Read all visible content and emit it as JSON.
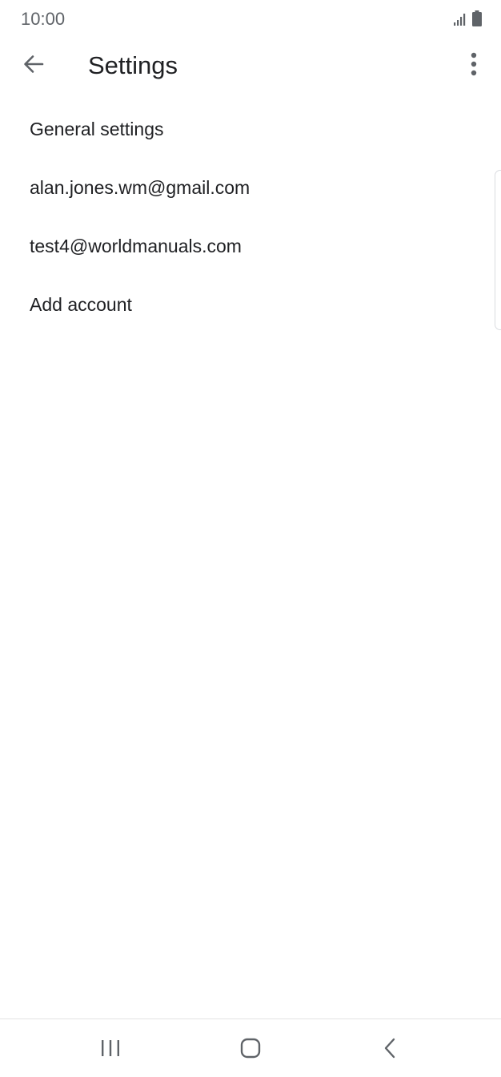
{
  "status_bar": {
    "time": "10:00",
    "signal_icon": "signal-icon",
    "battery_icon": "battery-icon"
  },
  "app_bar": {
    "title": "Settings",
    "back_icon": "back-arrow-icon",
    "overflow_icon": "more-vert-icon"
  },
  "settings_list": {
    "items": [
      {
        "label": "General settings"
      },
      {
        "label": "alan.jones.wm@gmail.com"
      },
      {
        "label": "test4@worldmanuals.com"
      },
      {
        "label": "Add account"
      }
    ]
  },
  "nav_bar": {
    "recents_icon": "recents-icon",
    "home_icon": "home-icon",
    "back_icon": "nav-back-icon"
  },
  "colors": {
    "text_primary": "#202124",
    "text_secondary": "#5f6368",
    "background": "#ffffff"
  }
}
